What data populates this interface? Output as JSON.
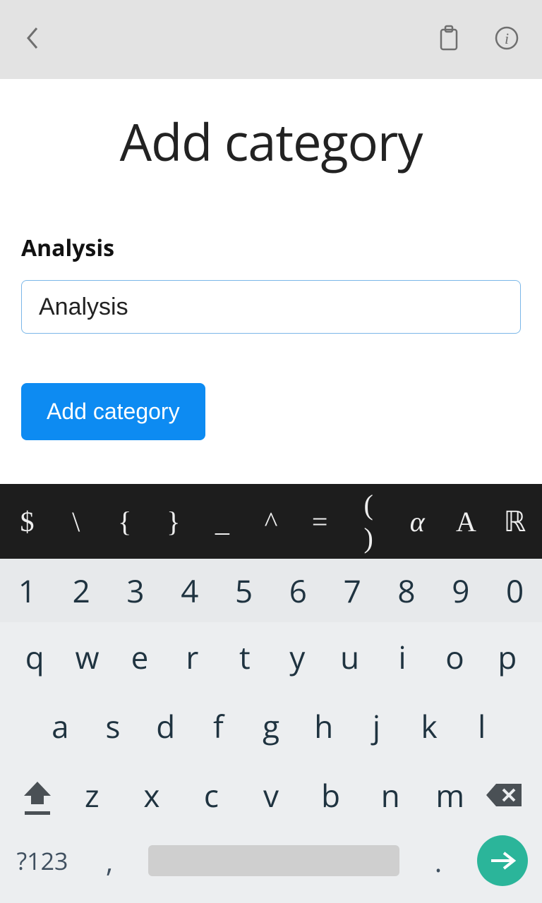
{
  "header": {
    "back_icon": "chevron-left",
    "clipboard_icon": "clipboard",
    "info_icon": "info"
  },
  "main": {
    "title": "Add category",
    "field_label": "Analysis",
    "input_value": "Analysis",
    "button_label": "Add category"
  },
  "keyboard": {
    "symbol_row": [
      "$",
      "\\",
      "{",
      "}",
      "_",
      "^",
      "=",
      "( )",
      "α",
      "A",
      "ℝ"
    ],
    "num_row": [
      "1",
      "2",
      "3",
      "4",
      "5",
      "6",
      "7",
      "8",
      "9",
      "0"
    ],
    "row1": [
      "q",
      "w",
      "e",
      "r",
      "t",
      "y",
      "u",
      "i",
      "o",
      "p"
    ],
    "row2": [
      "a",
      "s",
      "d",
      "f",
      "g",
      "h",
      "j",
      "k",
      "l"
    ],
    "row3": [
      "z",
      "x",
      "c",
      "v",
      "b",
      "n",
      "m"
    ],
    "mode_key": "?123",
    "comma": ",",
    "period": "."
  }
}
